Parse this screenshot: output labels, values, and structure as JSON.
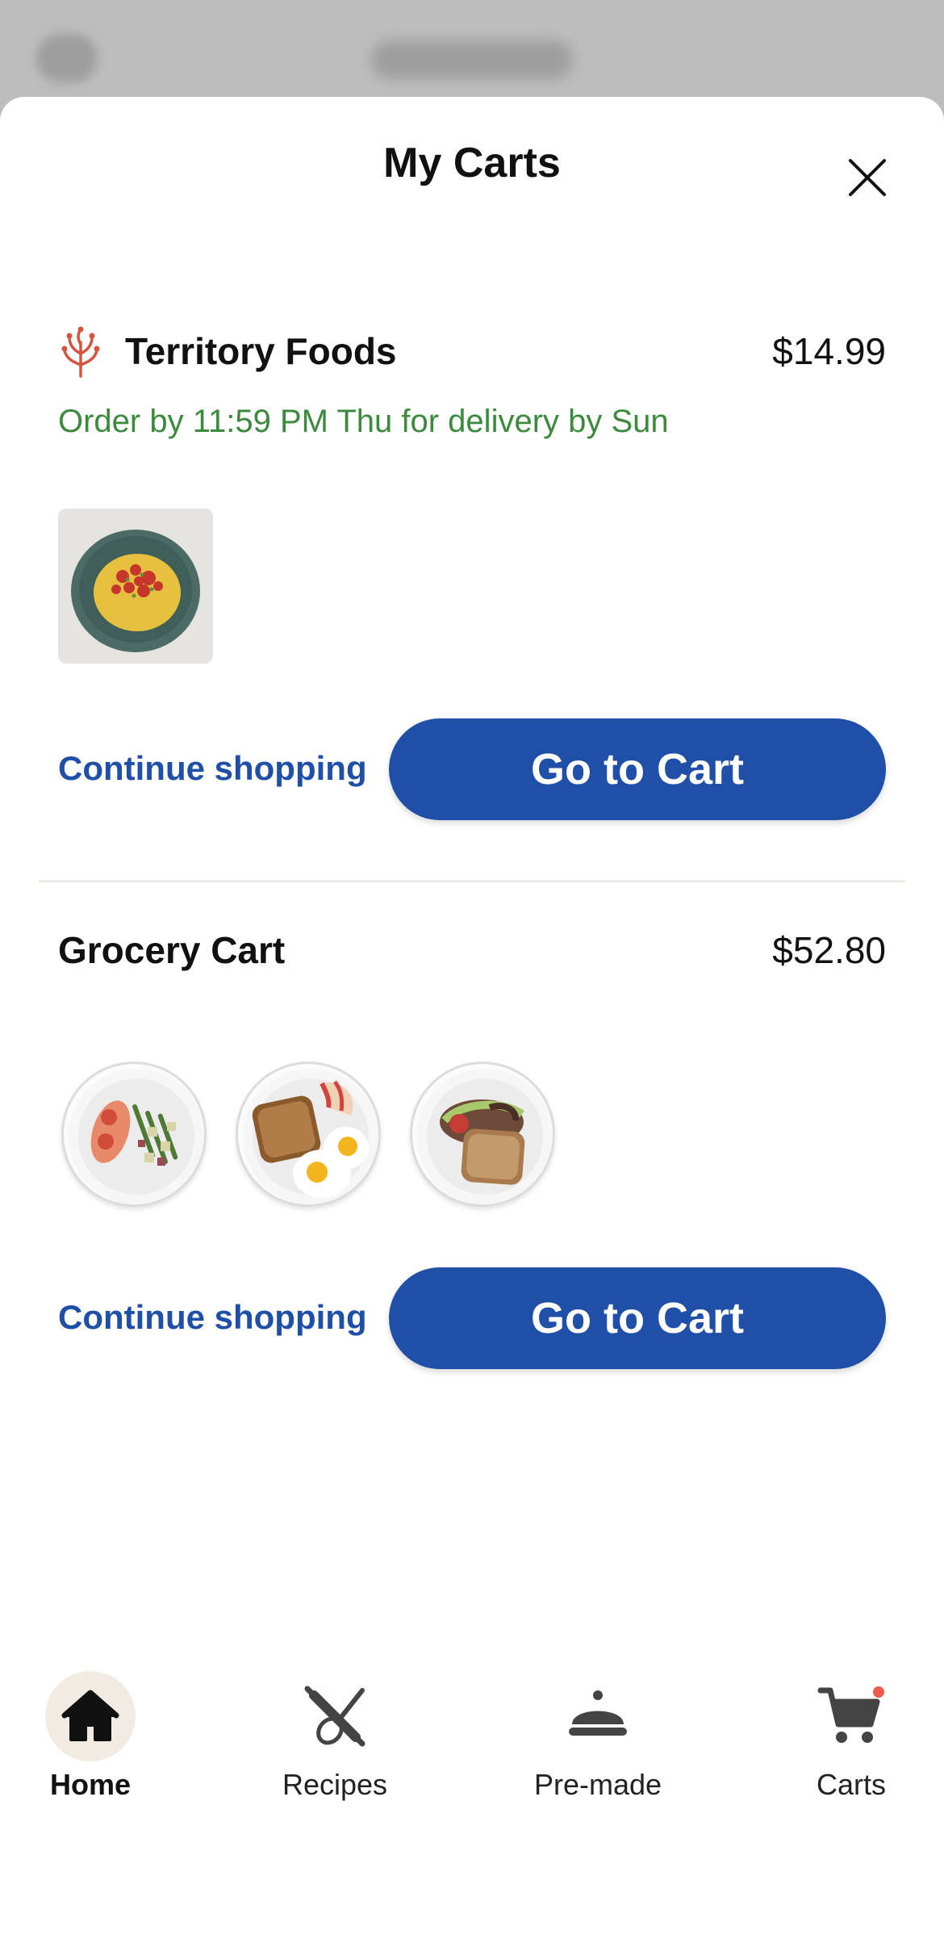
{
  "header": {
    "title": "My Carts",
    "close_label": "Close"
  },
  "carts": [
    {
      "vendor": "Territory Foods",
      "total": "$14.99",
      "delivery_note": "Order by 11:59 PM Thu for delivery by Sun",
      "continue_label": "Continue shopping",
      "cta_label": "Go to Cart",
      "thumb_count": 1
    },
    {
      "vendor": "Grocery Cart",
      "total": "$52.80",
      "continue_label": "Continue shopping",
      "cta_label": "Go to Cart",
      "thumb_count": 3
    }
  ],
  "nav": {
    "items": [
      {
        "label": "Home",
        "icon": "home-icon",
        "active": true
      },
      {
        "label": "Recipes",
        "icon": "rolling-pin-whisk-icon",
        "active": false
      },
      {
        "label": "Pre-made",
        "icon": "cloche-icon",
        "active": false
      },
      {
        "label": "Carts",
        "icon": "cart-icon",
        "active": false,
        "badge": true
      }
    ]
  },
  "colors": {
    "accent": "#1f4fa6",
    "delivery_green": "#3b8a3e",
    "brand_red": "#d4553f",
    "badge": "#f05a4f"
  }
}
